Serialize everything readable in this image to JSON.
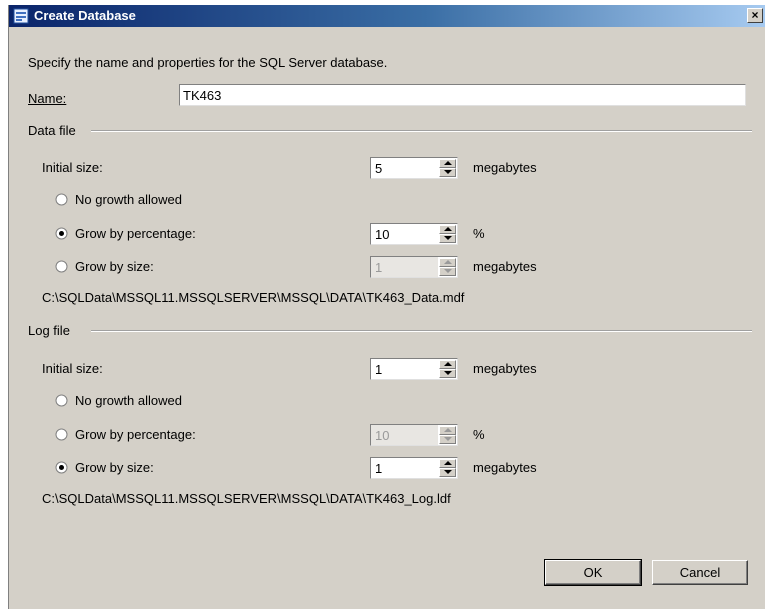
{
  "window": {
    "title": "Create Database",
    "close_glyph": "×"
  },
  "intro": "Specify the name and properties for the SQL Server database.",
  "name": {
    "label": "Name:",
    "value": "TK463"
  },
  "data_file": {
    "group_label": "Data file",
    "initial_size_label": "Initial size:",
    "initial_size_value": "5",
    "initial_size_unit": "megabytes",
    "no_growth_label": "No growth allowed",
    "grow_pct_label": "Grow by percentage:",
    "grow_pct_value": "10",
    "grow_pct_unit": "%",
    "grow_size_label": "Grow by size:",
    "grow_size_value": "1",
    "grow_size_unit": "megabytes",
    "selected_growth": "percentage",
    "path": "C:\\SQLData\\MSSQL11.MSSQLSERVER\\MSSQL\\DATA\\TK463_Data.mdf"
  },
  "log_file": {
    "group_label": "Log file",
    "initial_size_label": "Initial size:",
    "initial_size_value": "1",
    "initial_size_unit": "megabytes",
    "no_growth_label": "No growth allowed",
    "grow_pct_label": "Grow by percentage:",
    "grow_pct_value": "10",
    "grow_pct_unit": "%",
    "grow_size_label": "Grow by size:",
    "grow_size_value": "1",
    "grow_size_unit": "megabytes",
    "selected_growth": "size",
    "path": "C:\\SQLData\\MSSQL11.MSSQLSERVER\\MSSQL\\DATA\\TK463_Log.ldf"
  },
  "buttons": {
    "ok": "OK",
    "cancel": "Cancel"
  },
  "colors": {
    "face": "#d4d0c8",
    "title_start": "#0a246a",
    "title_end": "#a6caf0"
  }
}
